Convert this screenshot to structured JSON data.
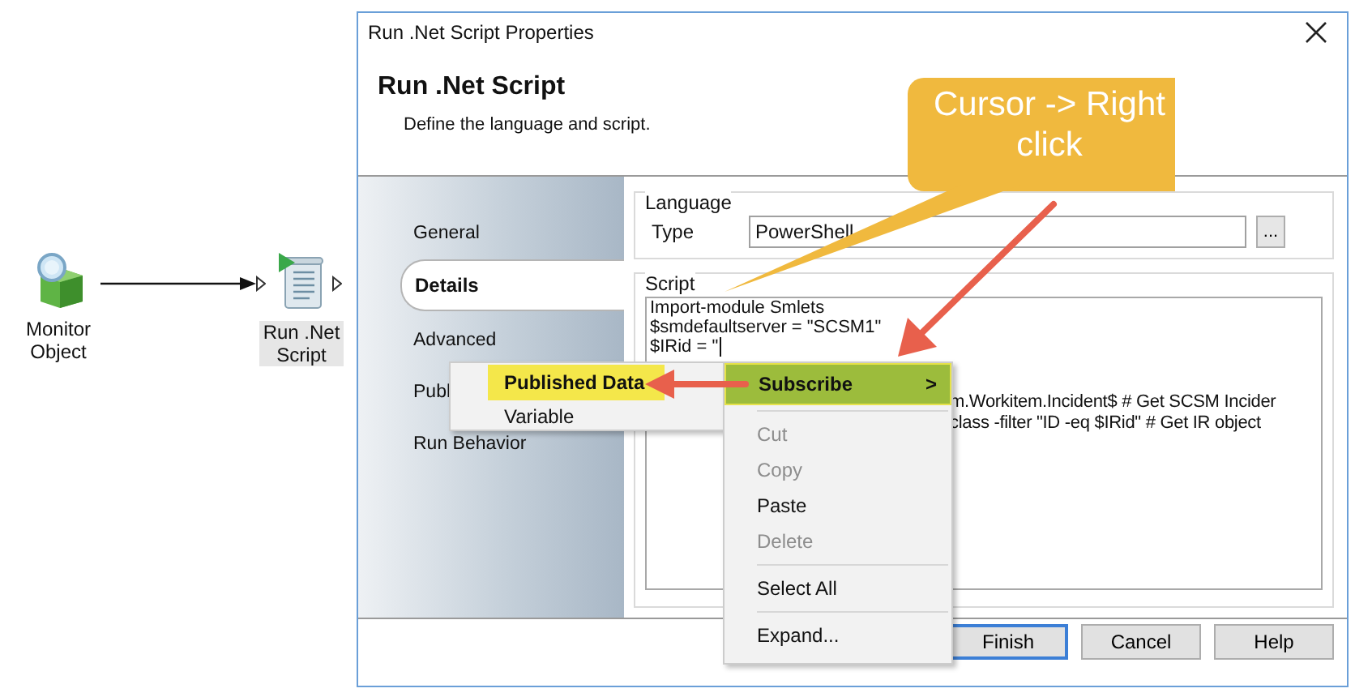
{
  "canvas": {
    "nodes": [
      {
        "kind": "monitor",
        "label": "Monitor Object",
        "selected": false
      },
      {
        "kind": "script",
        "label": "Run .Net Script",
        "selected": true
      }
    ]
  },
  "dialog": {
    "title": "Run .Net Script Properties",
    "heading": "Run .Net Script",
    "subtitle": "Define the language and script.",
    "tabs": [
      {
        "label": "General",
        "selected": false
      },
      {
        "label": "Details",
        "selected": true
      },
      {
        "label": "Advanced",
        "selected": false
      },
      {
        "label": "Publ",
        "selected": false
      },
      {
        "label": "Run Behavior",
        "selected": false
      }
    ],
    "language": {
      "group": "Language",
      "type_label": "Type",
      "value": "PowerShell",
      "browse": "..."
    },
    "script": {
      "group": "Script",
      "lines": [
        {
          "kind": "full",
          "text": "Import-module Smlets"
        },
        {
          "kind": "full",
          "text": "$smdefaultserver = \"SCSM1\""
        },
        {
          "kind": "cursor",
          "text": "$IRid = \""
        },
        {
          "kind": "tail",
          "text": "m.Workitem.Incident$ # Get SCSM Incider"
        },
        {
          "kind": "tail",
          "text": "class -filter \"ID -eq $IRid\" # Get IR object"
        }
      ]
    },
    "buttons": [
      {
        "label": "Finish",
        "focused": true
      },
      {
        "label": "Cancel",
        "focused": false
      },
      {
        "label": "Help",
        "focused": false
      }
    ]
  },
  "context_menu": {
    "items": [
      {
        "kind": "submenu",
        "label": "Subscribe",
        "arrow": ">",
        "selected": true,
        "disabled": false
      },
      {
        "kind": "separator"
      },
      {
        "kind": "item",
        "label": "Cut",
        "selected": false,
        "disabled": true
      },
      {
        "kind": "item",
        "label": "Copy",
        "selected": false,
        "disabled": true
      },
      {
        "kind": "item",
        "label": "Paste",
        "selected": false,
        "disabled": false
      },
      {
        "kind": "item",
        "label": "Delete",
        "selected": false,
        "disabled": true
      },
      {
        "kind": "separator"
      },
      {
        "kind": "item",
        "label": "Select All",
        "selected": false,
        "disabled": false
      },
      {
        "kind": "separator"
      },
      {
        "kind": "item",
        "label": "Expand...",
        "selected": false,
        "disabled": false
      }
    ]
  },
  "submenu": {
    "items": [
      {
        "label": "Published Data",
        "selected": true
      },
      {
        "label": "Variable",
        "selected": false
      }
    ]
  },
  "callout": {
    "text": "Cursor -> Right click"
  }
}
